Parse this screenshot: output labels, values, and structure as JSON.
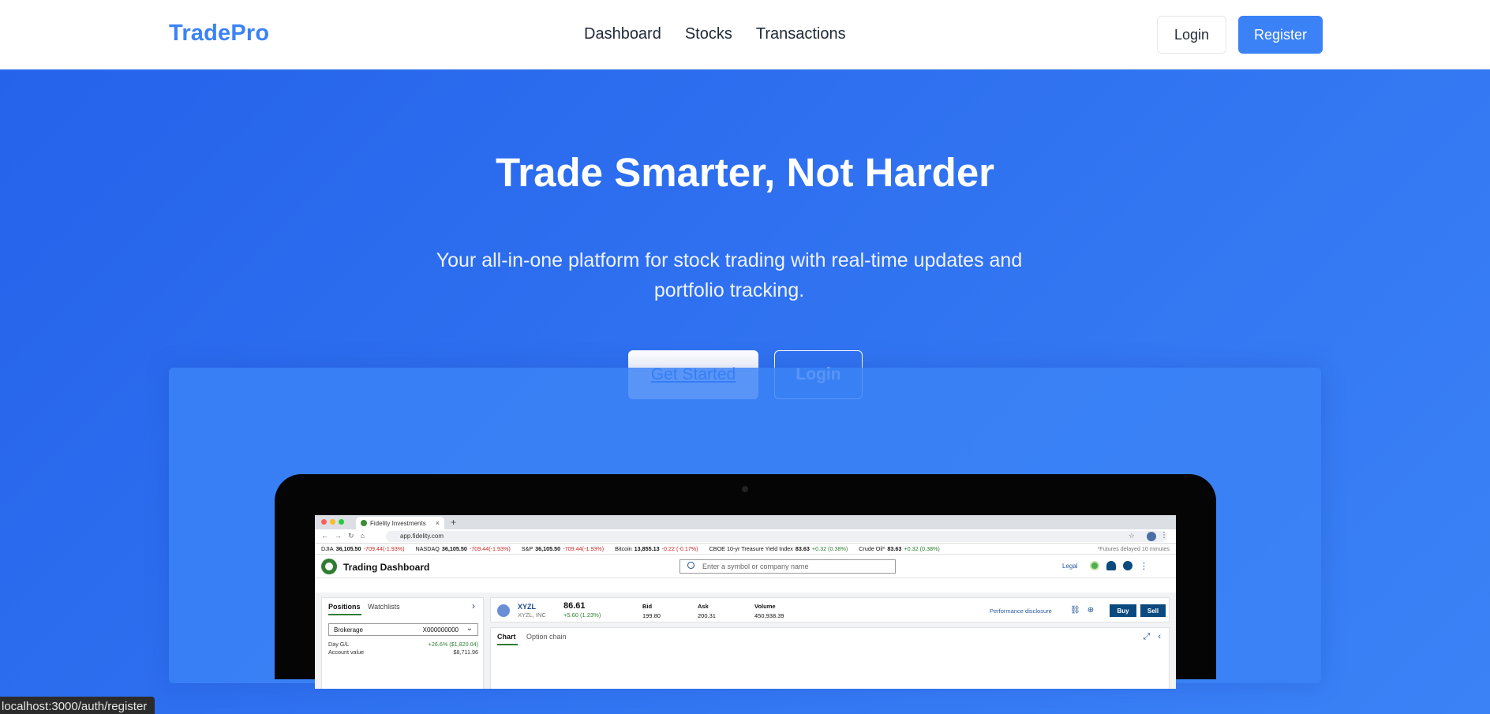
{
  "navbar": {
    "brand": "TradePro",
    "links": [
      "Dashboard",
      "Stocks",
      "Transactions"
    ],
    "login": "Login",
    "register": "Register"
  },
  "hero": {
    "title": "Trade Smarter, Not Harder",
    "subtitle": "Your all-in-one platform for stock trading with real-time updates and portfolio tracking.",
    "cta_primary": "Get Started",
    "cta_secondary": "Login"
  },
  "mock": {
    "browser": {
      "tab_title": "Fidelity Investments",
      "tab_close": "×",
      "new_tab": "+",
      "url": "app.fidelity.com"
    },
    "ticker": [
      {
        "name": "DJIA",
        "value": "36,105.50",
        "change": "-709.44(-1.93%)",
        "dir": "neg"
      },
      {
        "name": "NASDAQ",
        "value": "36,105.50",
        "change": "-709.44(-1.93%)",
        "dir": "neg"
      },
      {
        "name": "S&P",
        "value": "36,105.50",
        "change": "-709.44(-1.93%)",
        "dir": "neg"
      },
      {
        "name": "Bitcoin",
        "value": "13,855.13",
        "change": "-0.22 (-0.17%)",
        "dir": "neg"
      },
      {
        "name": "CBOE 10-yr Treasure Yield Index",
        "value": "83.63",
        "change": "+0.32 (0.38%)",
        "dir": "pos"
      },
      {
        "name": "Crude Oil*",
        "value": "83.63",
        "change": "+0.32 (0.38%)",
        "dir": "pos"
      }
    ],
    "ticker_note": "*Futures delayed 10 minutes",
    "app_title": "Trading Dashboard",
    "search_placeholder": "Enter a symbol or company name",
    "legal": "Legal",
    "side": {
      "tab_active": "Positions",
      "tab_inactive": "Watchlists",
      "account": "Brokerage",
      "account_number": "X000000000",
      "day_gl_label": "Day G/L",
      "day_gl_value": "+26.6% ($1,820.04)",
      "account_value_label": "Account value",
      "account_value": "$8,711.96"
    },
    "quote": {
      "symbol": "XYZL",
      "name": "XYZL, INC",
      "price": "86.61",
      "change": "+5.60 (1.23%)",
      "bid_label": "Bid",
      "bid": "199.80",
      "ask_label": "Ask",
      "ask": "200.31",
      "volume_label": "Volume",
      "volume": "450,938.39",
      "disclosure": "Performance disclosure",
      "buy": "Buy",
      "sell": "Sell"
    },
    "chart_tabs": {
      "active": "Chart",
      "inactive": "Option chain"
    }
  },
  "status_url": "localhost:3000/auth/register",
  "colors": {
    "primary": "#3b82f6",
    "hero_gradient_start": "#2563eb",
    "negative": "#c62828",
    "positive": "#2e7d32"
  }
}
